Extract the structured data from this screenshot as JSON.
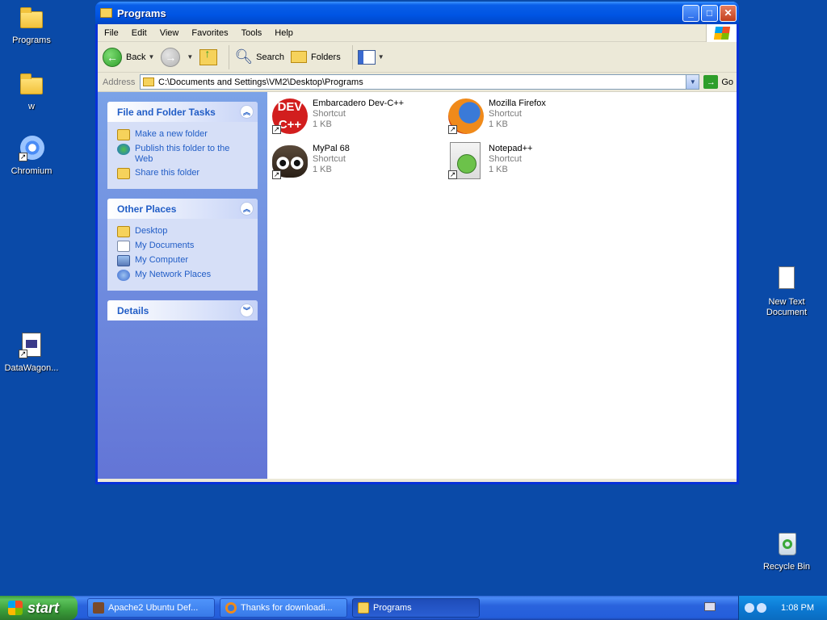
{
  "desktop": {
    "icons": [
      {
        "label": "Programs"
      },
      {
        "label": "w"
      },
      {
        "label": "Chromium"
      },
      {
        "label": "DataWagon..."
      },
      {
        "label": "New Text Document"
      },
      {
        "label": "Recycle Bin"
      }
    ]
  },
  "window": {
    "title": "Programs",
    "menu": [
      "File",
      "Edit",
      "View",
      "Favorites",
      "Tools",
      "Help"
    ],
    "toolbar": {
      "back": "Back",
      "search": "Search",
      "folders": "Folders"
    },
    "address": {
      "label": "Address",
      "path": "C:\\Documents and Settings\\VM2\\Desktop\\Programs",
      "go": "Go"
    },
    "taskpane": {
      "file_tasks": {
        "title": "File and Folder Tasks",
        "items": [
          "Make a new folder",
          "Publish this folder to the Web",
          "Share this folder"
        ]
      },
      "other_places": {
        "title": "Other Places",
        "items": [
          "Desktop",
          "My Documents",
          "My Computer",
          "My Network Places"
        ]
      },
      "details": {
        "title": "Details"
      }
    },
    "files": [
      {
        "name": "Embarcadero Dev-C++",
        "type": "Shortcut",
        "size": "1 KB",
        "icon": "devcpp-icon"
      },
      {
        "name": "Mozilla Firefox",
        "type": "Shortcut",
        "size": "1 KB",
        "icon": "firefox-icon"
      },
      {
        "name": "MyPal 68",
        "type": "Shortcut",
        "size": "1 KB",
        "icon": "mypal-icon"
      },
      {
        "name": "Notepad++",
        "type": "Shortcut",
        "size": "1 KB",
        "icon": "notepadpp-icon"
      }
    ],
    "dev_icon_text": "DEV C++"
  },
  "taskbar": {
    "start": "start",
    "tasks": [
      {
        "label": "Apache2 Ubuntu Def..."
      },
      {
        "label": "Thanks for downloadi..."
      },
      {
        "label": "Programs"
      }
    ],
    "clock": "1:08 PM"
  }
}
